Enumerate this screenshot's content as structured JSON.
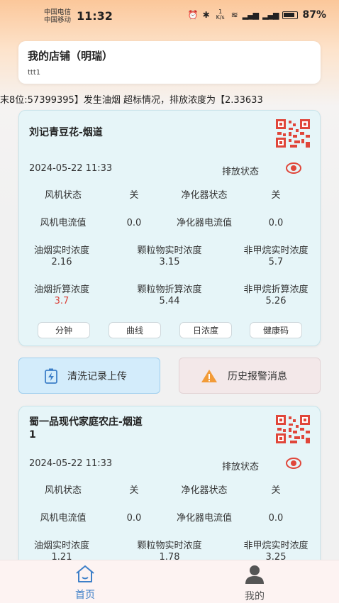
{
  "status_bar": {
    "carrier_1": "中国电信",
    "carrier_2": "中国移动",
    "time": "11:32",
    "net_speed": "1 K/s",
    "battery": "87%"
  },
  "shop": {
    "title": "我的店铺（明瑞）",
    "subtitle": "ttt1"
  },
  "marquee": "末8位:57399395】发生油烟 超标情况，排放浓度为【2.33633",
  "labels": {
    "emission_status": "排放状态",
    "fan_status": "风机状态",
    "purifier_status": "净化器状态",
    "fan_current": "风机电流值",
    "purifier_current": "净化器电流值",
    "smoke_realtime": "油烟实时浓度",
    "particle_realtime": "颗粒物实时浓度",
    "nmhc_realtime": "非甲烷实时浓度",
    "smoke_converted": "油烟折算浓度",
    "particle_converted": "颗粒物折算浓度",
    "nmhc_converted": "非甲烷折算浓度"
  },
  "buttons": {
    "minute": "分钟",
    "curve": "曲线",
    "daily": "日浓度",
    "health_code": "健康码",
    "clean_upload": "清洗记录上传",
    "alarm_history": "历史报警消息"
  },
  "devices": [
    {
      "name": "刘记青豆花-烟道",
      "time": "2024-05-22 11:33",
      "fan_status": "关",
      "purifier_status": "关",
      "fan_current": "0.0",
      "purifier_current": "0.0",
      "smoke_realtime": "2.16",
      "particle_realtime": "3.15",
      "nmhc_realtime": "5.7",
      "smoke_converted": "3.7",
      "particle_converted": "5.44",
      "nmhc_converted": "5.26"
    },
    {
      "name_line1": "蜀一品现代家庭农庄-烟道",
      "name_line2": "1",
      "time": "2024-05-22 11:33",
      "fan_status": "关",
      "purifier_status": "关",
      "fan_current": "0.0",
      "purifier_current": "0.0",
      "smoke_realtime": "1.21",
      "particle_realtime": "1.78",
      "nmhc_realtime": "3.25"
    }
  ],
  "nav": {
    "home": "首页",
    "me": "我的"
  },
  "colors": {
    "accent": "#3d7fc8",
    "alert_red": "#d9423a",
    "qr_red": "#e0463a",
    "warning_orange": "#f29b38"
  }
}
